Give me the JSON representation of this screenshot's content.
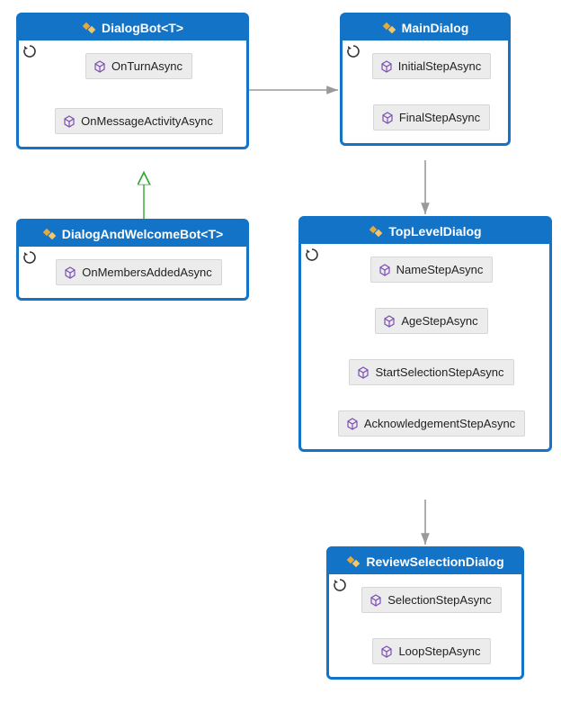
{
  "classes": {
    "dialogBot": {
      "title": "DialogBot<T>",
      "methods": [
        "OnTurnAsync",
        "OnMessageActivityAsync"
      ]
    },
    "dialogAndWelcomeBot": {
      "title": "DialogAndWelcomeBot<T>",
      "methods": [
        "OnMembersAddedAsync"
      ]
    },
    "mainDialog": {
      "title": "MainDialog",
      "methods": [
        "InitialStepAsync",
        "FinalStepAsync"
      ]
    },
    "topLevelDialog": {
      "title": "TopLevelDialog",
      "methods": [
        "NameStepAsync",
        "AgeStepAsync",
        "StartSelectionStepAsync",
        "AcknowledgementStepAsync"
      ]
    },
    "reviewSelectionDialog": {
      "title": "ReviewSelectionDialog",
      "methods": [
        "SelectionStepAsync",
        "LoopStepAsync"
      ]
    }
  }
}
